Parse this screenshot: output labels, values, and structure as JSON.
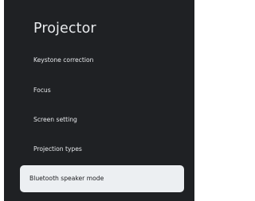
{
  "header": {
    "title": "Projector"
  },
  "menu": {
    "items": [
      {
        "label": "Keystone correction"
      },
      {
        "label": "Focus"
      },
      {
        "label": "Screen setting"
      },
      {
        "label": "Projection types"
      },
      {
        "label": "Bluetooth speaker mode",
        "selected": true
      }
    ]
  }
}
